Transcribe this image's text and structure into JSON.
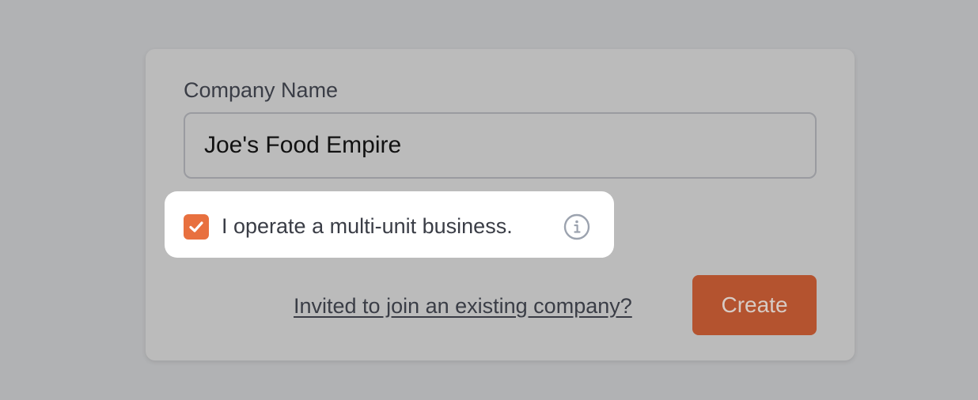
{
  "form": {
    "company_label": "Company Name",
    "company_value": "Joe's Food Empire",
    "multi_unit_label": "I operate a multi-unit business.",
    "multi_unit_checked": true,
    "invite_link": "Invited to join an existing company?",
    "create_label": "Create"
  },
  "icons": {
    "checkbox": "check-icon",
    "info": "info-icon"
  },
  "colors": {
    "backdrop": "#b1b2b4",
    "card": "#bbbbbb",
    "accent_checkbox": "#e8703f",
    "create_button": "#b4532f",
    "create_text": "#d7cbc5",
    "text": "#3a3d46",
    "info_icon": "#9ca3af"
  }
}
